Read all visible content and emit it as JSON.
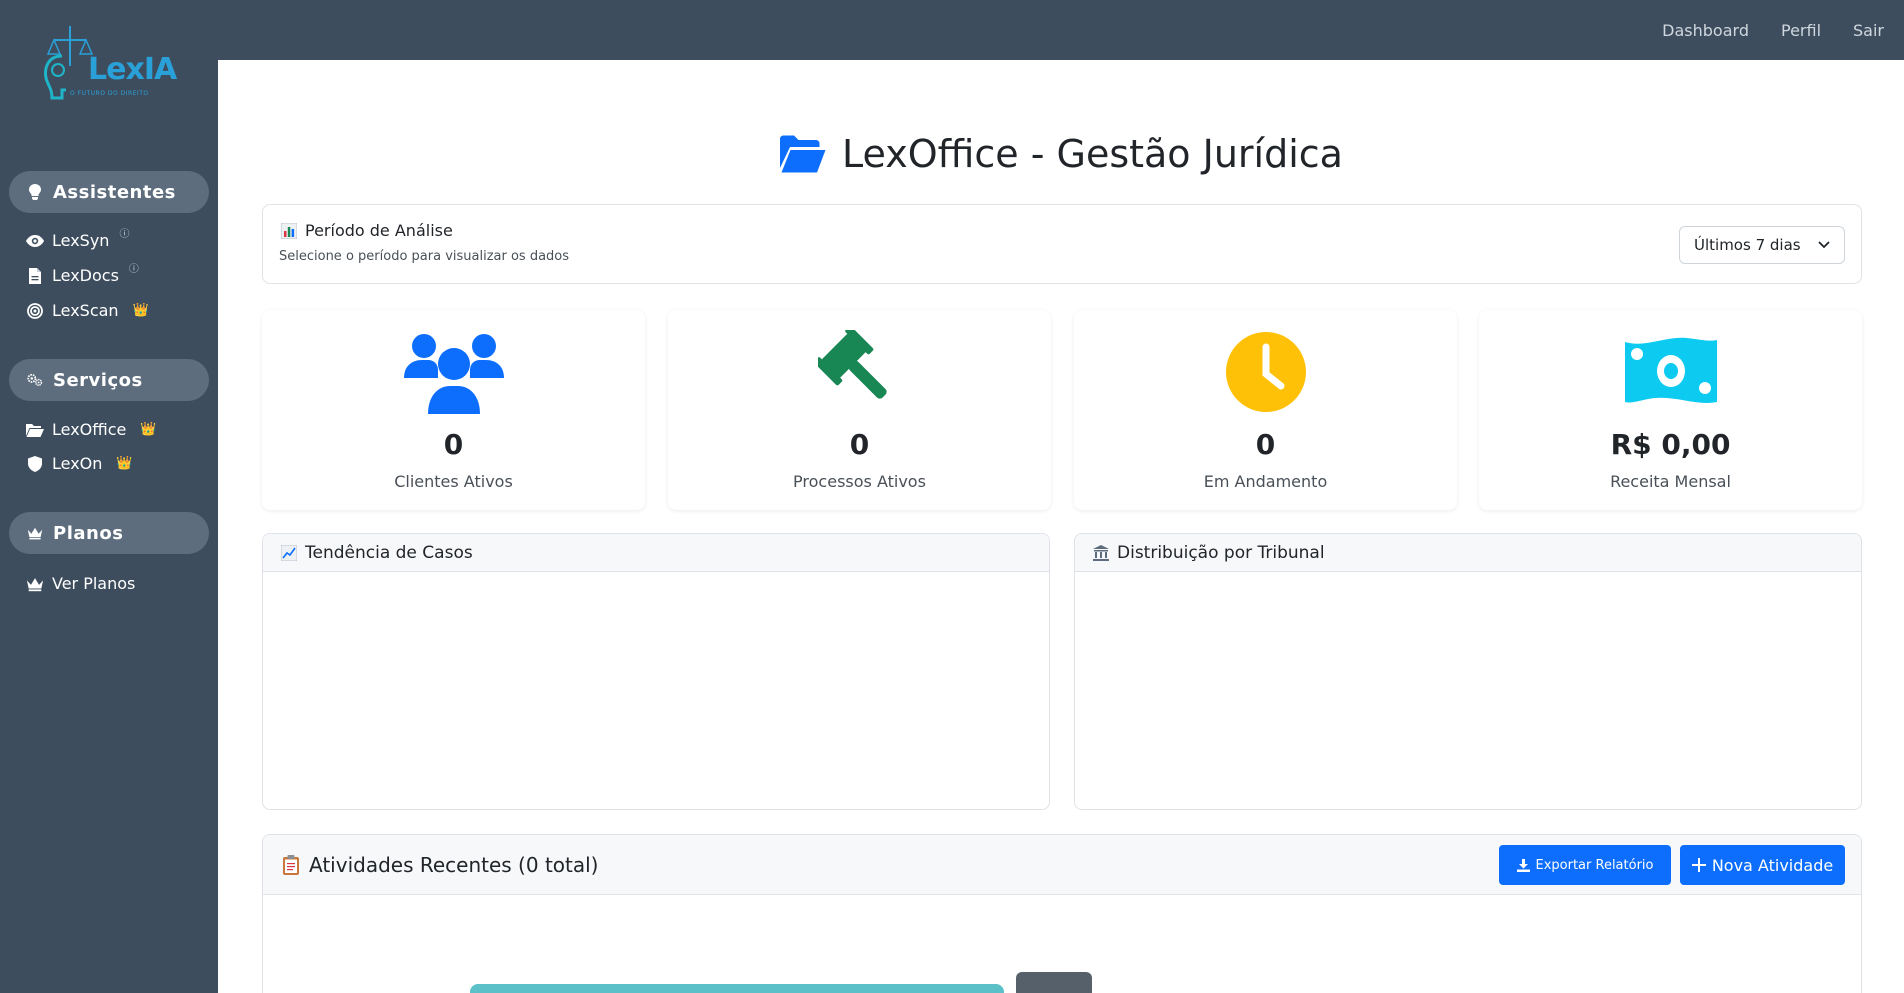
{
  "topnav": {
    "items": [
      "Dashboard",
      "Perfil",
      "Sair"
    ]
  },
  "logo": {
    "text": "LexIA",
    "subtitle": "O FUTURO DO DIREITO"
  },
  "sidebar": {
    "sections": [
      {
        "title": "Assistentes",
        "icon": "lightbulb-icon"
      },
      {
        "title": "Serviços",
        "icon": "gears-icon"
      },
      {
        "title": "Planos",
        "icon": "crown-icon"
      }
    ],
    "items": [
      {
        "label": "LexSyn",
        "icon": "eye-icon",
        "badge": "ⓘ"
      },
      {
        "label": "LexDocs",
        "icon": "document-icon",
        "badge": "ⓘ"
      },
      {
        "label": "LexScan",
        "icon": "scan-icon",
        "badge": "👑"
      },
      {
        "label": "LexOffice",
        "icon": "folder-icon",
        "badge": "👑"
      },
      {
        "label": "LexOn",
        "icon": "shield-icon",
        "badge": "👑"
      },
      {
        "label": "Ver Planos",
        "icon": "crown-icon",
        "badge": ""
      }
    ]
  },
  "page": {
    "title": "LexOffice - Gestão Jurídica"
  },
  "period": {
    "title": "Período de Análise",
    "subtitle": "Selecione o período para visualizar os dados",
    "selected": "Últimos 7 dias"
  },
  "stats": [
    {
      "value": "0",
      "label": "Clientes Ativos",
      "color": "#0d6efd",
      "icon": "users-icon"
    },
    {
      "value": "0",
      "label": "Processos Ativos",
      "color": "#198754",
      "icon": "gavel-icon"
    },
    {
      "value": "0",
      "label": "Em Andamento",
      "color": "#ffc107",
      "icon": "clock-icon"
    },
    {
      "value": "R$ 0,00",
      "label": "Receita Mensal",
      "color": "#0dcaf0",
      "icon": "money-icon"
    }
  ],
  "panels": {
    "trend": "Tendência de Casos",
    "distribution": "Distribuição por Tribunal"
  },
  "activities": {
    "title": "Atividades Recentes (0 total)",
    "export_label": "Exportar Relatório",
    "new_label": "Nova Atividade"
  }
}
